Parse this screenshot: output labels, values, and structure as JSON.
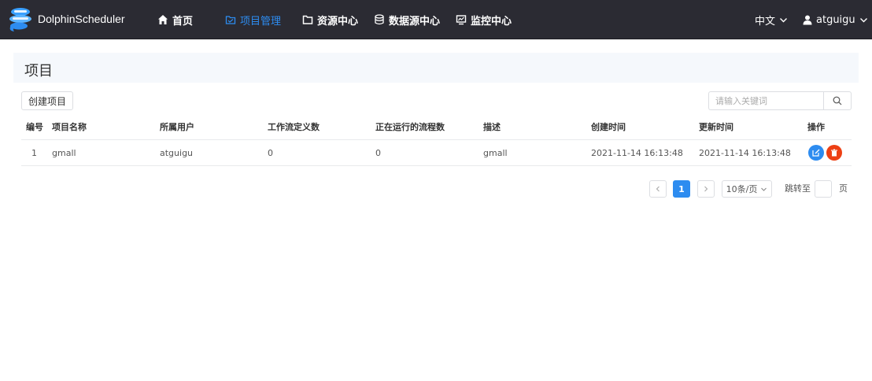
{
  "navbar": {
    "brand": "DolphinScheduler",
    "items": [
      {
        "label": "首页",
        "icon": "home-icon",
        "active": false
      },
      {
        "label": "项目管理",
        "icon": "project-icon",
        "active": true
      },
      {
        "label": "资源中心",
        "icon": "folder-icon",
        "active": false
      },
      {
        "label": "数据源中心",
        "icon": "database-icon",
        "active": false
      },
      {
        "label": "监控中心",
        "icon": "monitor-icon",
        "active": false
      }
    ],
    "language": "中文",
    "user": "atguigu",
    "active_color": "#2d8cf0",
    "bg_color": "#2b2b33"
  },
  "page": {
    "title": "项目",
    "create_button": "创建项目",
    "search": {
      "placeholder": "请输入关键词",
      "value": ""
    }
  },
  "table": {
    "columns": [
      "编号",
      "项目名称",
      "所属用户",
      "工作流定义数",
      "正在运行的流程数",
      "描述",
      "创建时间",
      "更新时间",
      "操作"
    ],
    "rows": [
      {
        "id": "1",
        "name": "gmall",
        "user": "atguigu",
        "definitions": "0",
        "running": "0",
        "description": "gmall",
        "created": "2021-11-14 16:13:48",
        "updated": "2021-11-14 16:13:48"
      }
    ]
  },
  "pagination": {
    "current_page": "1",
    "page_size": "10条/页",
    "jump_label": "跳转至",
    "page_suffix": "页"
  }
}
